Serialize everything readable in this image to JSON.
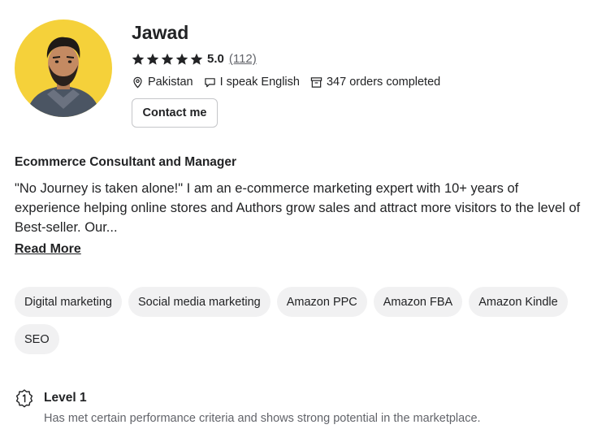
{
  "profile": {
    "name": "Jawad",
    "rating": "5.0",
    "review_count": "(112)",
    "location": "Pakistan",
    "languages": "I speak English",
    "orders": "347 orders completed",
    "contact_label": "Contact me",
    "stars": 5
  },
  "about": {
    "headline": "Ecommerce Consultant and Manager",
    "description": "\"No Journey is taken alone!\" I am an e-commerce marketing expert with 10+ years of experience helping online stores and Authors grow sales and attract more visitors to the level of Best-seller. Our...",
    "read_more": "Read More"
  },
  "skills": [
    "Digital marketing",
    "Social media marketing",
    "Amazon PPC",
    "Amazon FBA",
    "Amazon Kindle",
    "SEO"
  ],
  "level": {
    "title": "Level 1",
    "description": "Has met certain performance criteria and shows strong potential in the marketplace."
  },
  "colors": {
    "avatar_bg": "#f5d13a",
    "text": "#222325",
    "muted": "#62646a",
    "chip_bg": "#f1f1f2"
  }
}
